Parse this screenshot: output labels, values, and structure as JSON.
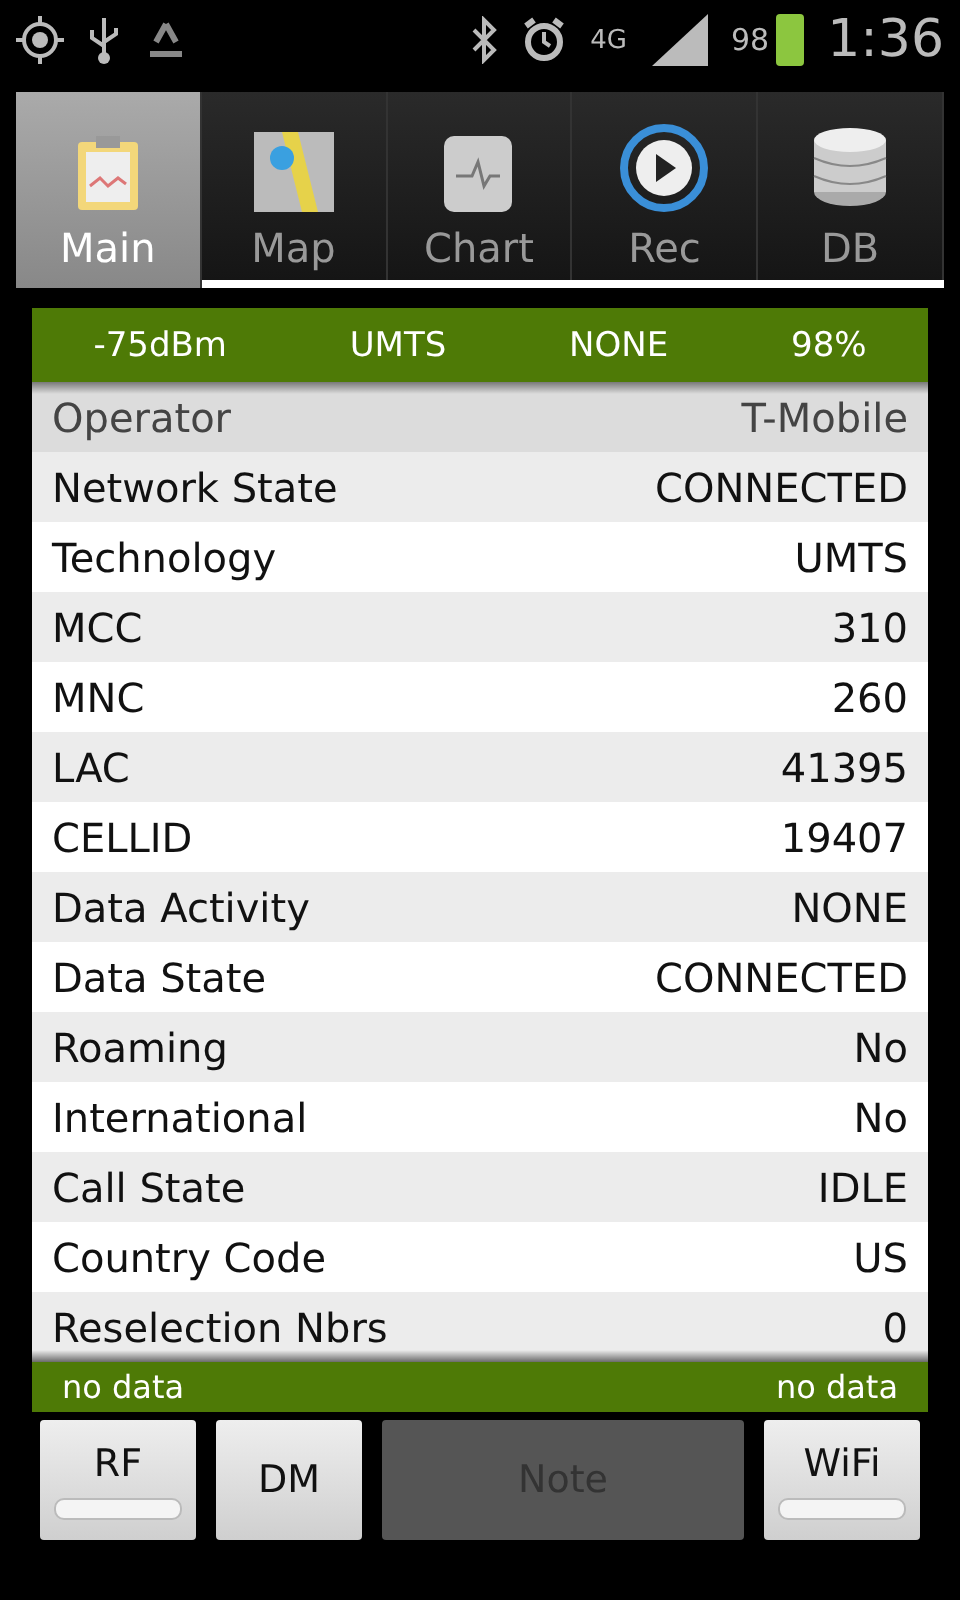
{
  "status_bar": {
    "network": "4G",
    "battery": "98",
    "time": "1:36"
  },
  "tabs": [
    {
      "label": "Main",
      "kind": "clipboard",
      "selected": true
    },
    {
      "label": "Map",
      "kind": "map",
      "selected": false
    },
    {
      "label": "Chart",
      "kind": "chart",
      "selected": false
    },
    {
      "label": "Rec",
      "kind": "rec",
      "selected": false
    },
    {
      "label": "DB",
      "kind": "db",
      "selected": false
    }
  ],
  "summary": [
    "-75dBm",
    "UMTS",
    "NONE",
    "98%"
  ],
  "partial_row": {
    "label": "Operator",
    "value": "T-Mobile"
  },
  "rows": [
    {
      "label": "Network State",
      "value": "CONNECTED"
    },
    {
      "label": "Technology",
      "value": "UMTS"
    },
    {
      "label": "MCC",
      "value": "310"
    },
    {
      "label": "MNC",
      "value": "260"
    },
    {
      "label": "LAC",
      "value": "41395"
    },
    {
      "label": "CELLID",
      "value": "19407"
    },
    {
      "label": "Data Activity",
      "value": "NONE"
    },
    {
      "label": "Data State",
      "value": "CONNECTED"
    },
    {
      "label": "Roaming",
      "value": "No"
    },
    {
      "label": "International",
      "value": "No"
    },
    {
      "label": "Call State",
      "value": "IDLE"
    },
    {
      "label": "Country Code",
      "value": "US"
    },
    {
      "label": "Reselection Nbrs",
      "value": "0"
    }
  ],
  "footer": [
    "no data",
    "no data"
  ],
  "buttons": [
    {
      "label": "RF",
      "kind": "toggle",
      "on": false
    },
    {
      "label": "DM",
      "kind": "button"
    },
    {
      "label": "Note",
      "kind": "button",
      "disabled": true
    },
    {
      "label": "WiFi",
      "kind": "toggle",
      "on": false
    }
  ]
}
